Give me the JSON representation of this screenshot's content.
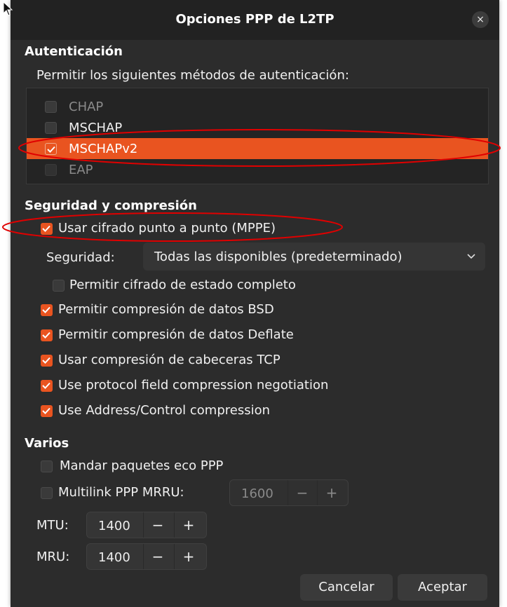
{
  "window": {
    "title": "Opciones PPP de L2TP",
    "close_label": "×"
  },
  "auth": {
    "heading": "Autenticación",
    "subtitle": "Permitir los siguientes métodos de autenticación:",
    "methods": [
      {
        "label": "CHAP",
        "checked": false,
        "enabled": false
      },
      {
        "label": "MSCHAP",
        "checked": false,
        "enabled": true
      },
      {
        "label": "MSCHAPv2",
        "checked": true,
        "enabled": true,
        "selected": true
      },
      {
        "label": "EAP",
        "checked": false,
        "enabled": false
      }
    ]
  },
  "security": {
    "heading": "Seguridad y compresión",
    "mppe_label": "Usar cifrado punto a punto (MPPE)",
    "security_label": "Seguridad:",
    "security_value": "Todas las disponibles (predeterminado)",
    "stateful_label": "Permitir cifrado de estado completo",
    "bsd_label": "Permitir compresión de datos BSD",
    "deflate_label": "Permitir compresión de datos Deflate",
    "tcp_label": "Usar compresión de cabeceras TCP",
    "protocol_label": "Use protocol field compression negotiation",
    "address_label": "Use Address/Control compression"
  },
  "misc": {
    "heading": "Varios",
    "echo_label": "Mandar paquetes eco PPP",
    "multilink_label": "Multilink PPP MRRU:",
    "mrru_value": "1600",
    "mtu_label": "MTU:",
    "mtu_value": "1400",
    "mru_label": "MRU:",
    "mru_value": "1400",
    "minus": "−",
    "plus": "+"
  },
  "buttons": {
    "cancel": "Cancelar",
    "accept": "Aceptar"
  },
  "colors": {
    "accent": "#e95420",
    "annotation": "#e00000",
    "background": "#2c2c2c"
  }
}
